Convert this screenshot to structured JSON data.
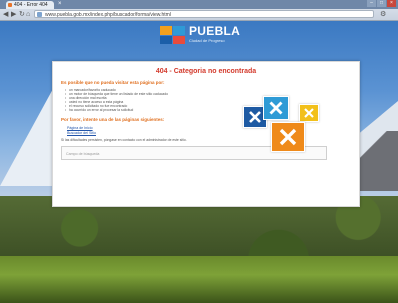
{
  "browser": {
    "tab_title": "404 - Error 404",
    "tab_close": "×",
    "url": "www.puebla.gob.mx/index.php/buscador/forma/view.html",
    "back_icon": "back-arrow-icon",
    "forward_icon": "forward-arrow-icon",
    "reload_icon": "reload-icon",
    "home_icon": "home-icon",
    "menu_icon": "wrench-icon"
  },
  "brand": {
    "name": "PUEBLA",
    "tagline": "Ciudad de Progreso"
  },
  "error": {
    "title": "404 - Categoria no encontrada",
    "subtitle": "Es posible que no pueda visitar esta página por:",
    "reasons": [
      "un marcador/favorito caducado",
      "un motor de búsqueda que tiene un listado de este sitio caducado",
      "una dirección mal escrita",
      "usted no tiene acceso a esta página",
      "el recurso solicitado no fue encontrado",
      "ha ocurrido un error al procesar la solicitud"
    ],
    "subtitle2": "Por favor, intente una de las páginas siguientes:",
    "links": [
      "Página de Inicio",
      "Buscador del Sitio"
    ],
    "note": "Si las dificultades persisten, póngase en contacto con el administrador de este sitio.",
    "search_placeholder": "Campo de búsqueda"
  },
  "colors": {
    "title_red": "#d33a2c",
    "subtitle_orange": "#e07020",
    "link_blue": "#2255aa"
  }
}
